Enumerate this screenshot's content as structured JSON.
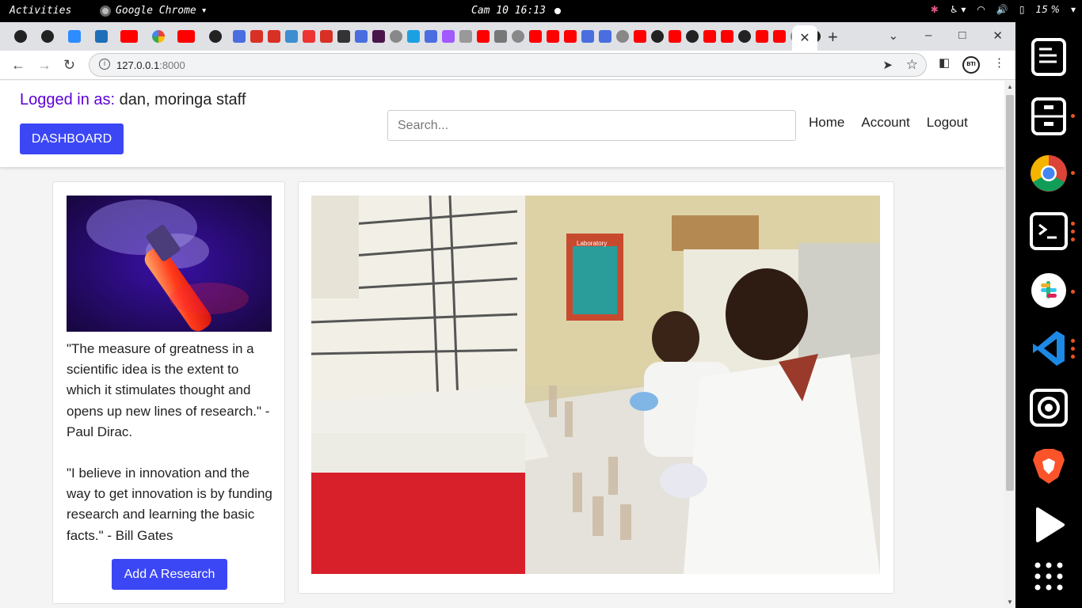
{
  "system_bar": {
    "activities": "Activities",
    "app_name": "Google Chrome",
    "clock": "Cam 10 16:13",
    "battery": "15 %"
  },
  "browser": {
    "url_host": "127.0.0.1",
    "url_port": ":8000",
    "profile_badge": "BTI"
  },
  "site": {
    "login_label": "Logged in as:",
    "login_user": "dan, moringa staff",
    "dashboard_button": "DASHBOARD",
    "search_placeholder": "Search...",
    "nav": [
      "Home",
      "Account",
      "Logout"
    ],
    "quotes": [
      "\"The measure of greatness in a scientific idea is the extent to which it stimulates thought and opens up new lines of research.\" - Paul Dirac.",
      "\"I believe in innovation and the way to get innovation is by funding research and learning the basic facts.\" - Bill Gates"
    ],
    "add_research_button": "Add A Research",
    "lab_poster_text": "Laboratory"
  },
  "colors": {
    "accent_button": "#3b47f5",
    "login_label": "#5b00d6",
    "dock_indicator": "#e95420"
  },
  "dock_icons": [
    "text-editor-icon",
    "file-cabinet-icon",
    "chrome-icon",
    "terminal-icon",
    "slack-icon",
    "vscode-icon",
    "screen-recorder-icon",
    "brave-icon",
    "video-player-icon",
    "app-grid-icon"
  ]
}
